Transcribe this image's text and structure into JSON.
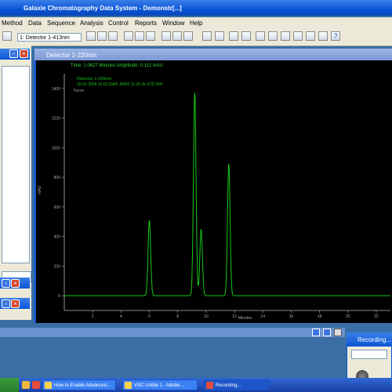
{
  "app": {
    "title": "Galaxie Chromatography Data System - Demonstr[...]"
  },
  "menu": [
    "Method",
    "Data",
    "Sequence",
    "Analysis",
    "Control",
    "Reports",
    "Window",
    "Help"
  ],
  "toolbar": {
    "detector_select": "1: Detector 1-413nm"
  },
  "chrom_window": {
    "title": "Detector 1-220nm",
    "status_line": "Time: 1.0627 Minutes   Amplitude: 0.111 mAU",
    "legend_line1": "Detector 1-220nm",
    "legend_line2": "10-01-2006 16:03 Drill5 J0002 11-25-3c STD WH",
    "y_unit": "mAU",
    "x_label": "Minutes",
    "left_label": "Name"
  },
  "chart_data": {
    "type": "line",
    "title": "",
    "xlabel": "Minutes",
    "ylabel": "mAU",
    "xlim": [
      0,
      23
    ],
    "ylim": [
      -100,
      1500
    ],
    "x_ticks": [
      2,
      4,
      6,
      8,
      10,
      12,
      14,
      16,
      18,
      20,
      22
    ],
    "y_ticks": [
      0,
      200,
      400,
      600,
      800,
      1000,
      1200,
      1400
    ],
    "series": [
      {
        "color": "#19c719",
        "peaks": [
          {
            "x": 6.0,
            "y": 510
          },
          {
            "x": 9.2,
            "y": 1370
          },
          {
            "x": 9.65,
            "y": 450
          },
          {
            "x": 11.6,
            "y": 890
          }
        ],
        "baseline": 0
      }
    ]
  },
  "recording": {
    "title": "Recording..."
  },
  "taskbar": {
    "tasks": [
      "How to Enable Advanced...",
      "VSC Untitle 1 - Adobe...",
      "Recording..."
    ]
  },
  "colors": {
    "plot_bg": "#000000",
    "trace": "#19c719",
    "axis": "#b8b8b8",
    "titlebar": "#0a55d6"
  }
}
